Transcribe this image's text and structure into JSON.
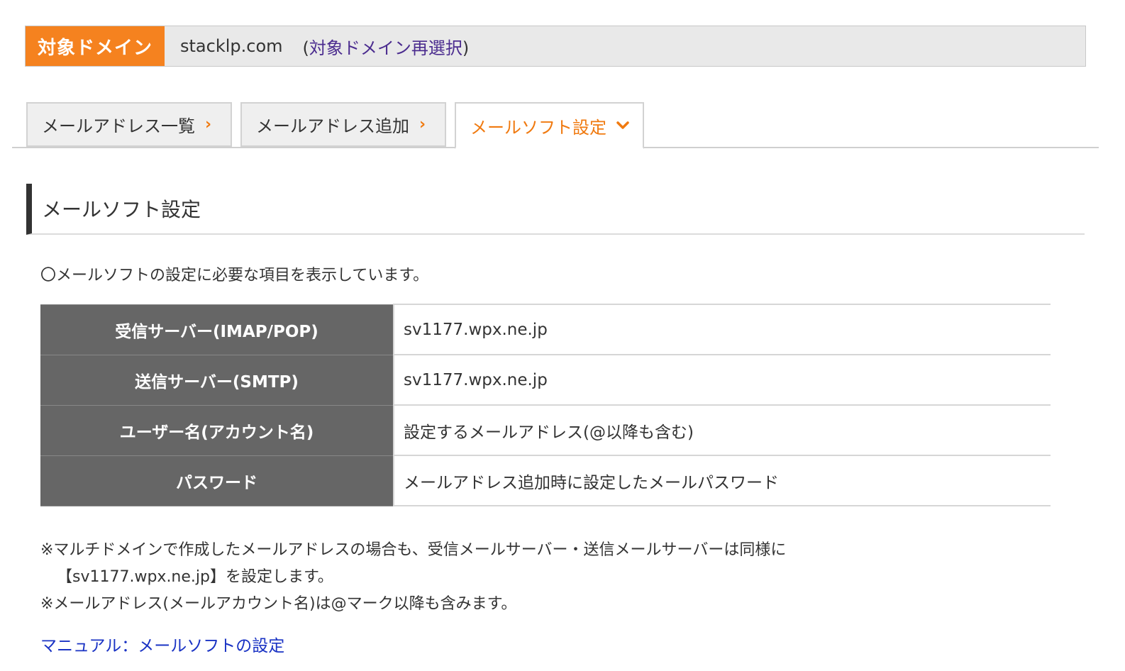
{
  "domain_bar": {
    "label": "対象ドメイン",
    "domain": "stacklp.com",
    "reselect_open": "(",
    "reselect_link": "対象ドメイン再選択",
    "reselect_close": ")"
  },
  "tabs": [
    {
      "label": "メールアドレス一覧",
      "chevron": "›",
      "active": false
    },
    {
      "label": "メールアドレス追加",
      "chevron": "›",
      "active": false
    },
    {
      "label": "メールソフト設定",
      "chevron": "⌄",
      "active": true
    }
  ],
  "section": {
    "title": "メールソフト設定",
    "intro": "〇メールソフトの設定に必要な項目を表示しています。"
  },
  "settings_table": [
    {
      "label": "受信サーバー(IMAP/POP)",
      "value": "sv1177.wpx.ne.jp"
    },
    {
      "label": "送信サーバー(SMTP)",
      "value": "sv1177.wpx.ne.jp"
    },
    {
      "label": "ユーザー名(アカウント名)",
      "value": "設定するメールアドレス(@以降も含む)"
    },
    {
      "label": "パスワード",
      "value": "メールアドレス追加時に設定したメールパスワード"
    }
  ],
  "notes": {
    "line1": "※マルチドメインで作成したメールアドレスの場合も、受信メールサーバー・送信メールサーバーは同様に",
    "line1b": "【sv1177.wpx.ne.jp】を設定します。",
    "line2": "※メールアドレス(メールアカウント名)は@マーク以降も含みます。"
  },
  "manual_link": "マニュアル：メールソフトの設定",
  "colors": {
    "accent": "#f5821f",
    "link": "#1a33c4",
    "table_header": "#666666"
  }
}
